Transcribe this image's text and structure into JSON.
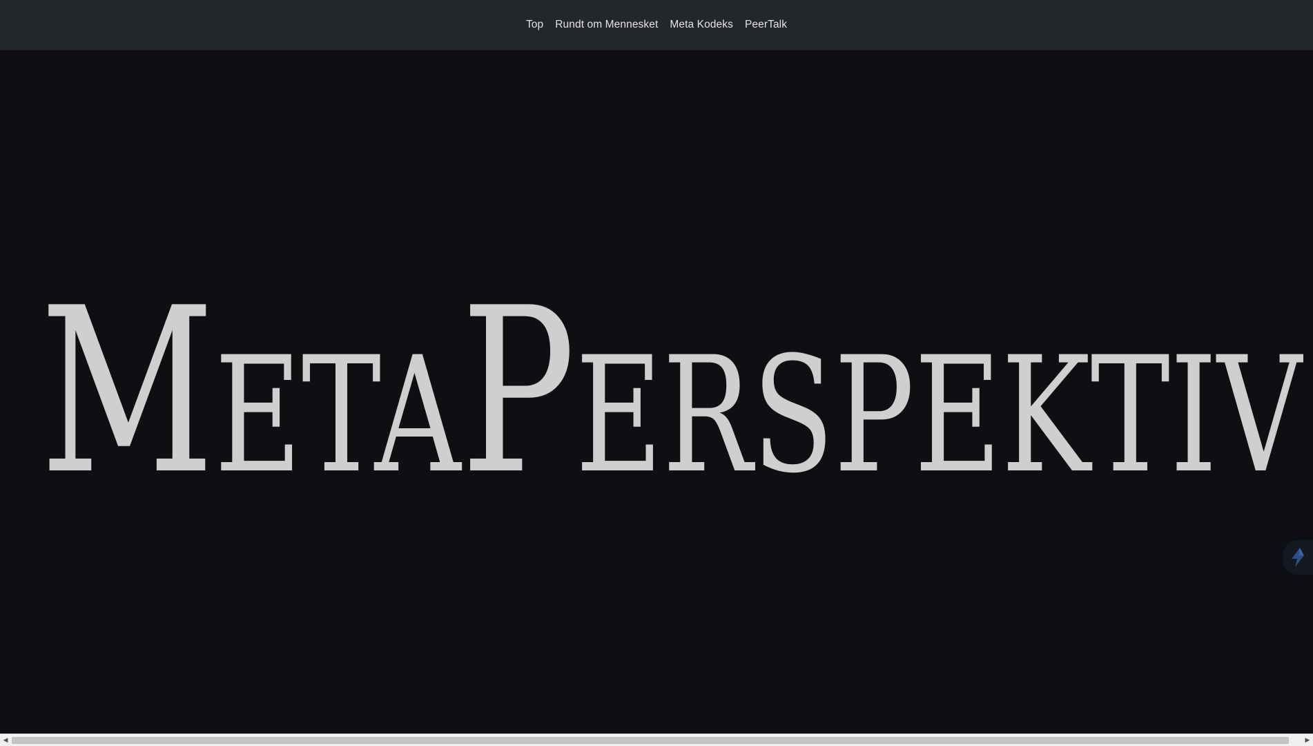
{
  "navbar": {
    "items": [
      {
        "label": "Top"
      },
      {
        "label": "Rundt om Mennesket"
      },
      {
        "label": "Meta Kodeks"
      },
      {
        "label": "PeerTalk"
      }
    ]
  },
  "hero": {
    "title": "MetaPerspektiv"
  },
  "floating_widget": {
    "icon": "lightning-bolt-icon"
  },
  "colors": {
    "navbar_bg": "#23262b",
    "page_bg": "#0e0f12",
    "title_text": "#cfcfcf",
    "nav_text": "#e4e4e4",
    "widget_icon": "#2c4e86"
  }
}
